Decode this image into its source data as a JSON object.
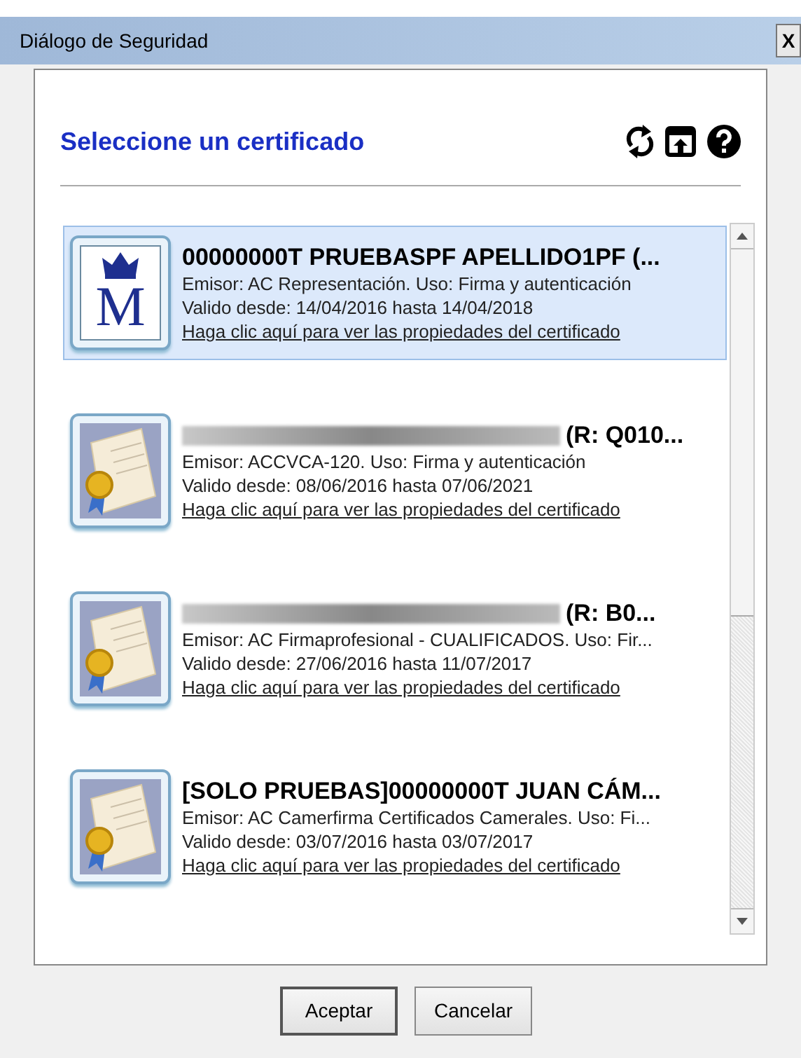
{
  "window": {
    "title": "Diálogo de Seguridad",
    "close_label": "X"
  },
  "header": {
    "title": "Seleccione un certificado"
  },
  "certificates": [
    {
      "kind": "emblem",
      "logo_letter": "M",
      "selected": true,
      "name_blurred": false,
      "name": "00000000T PRUEBASPF APELLIDO1PF (...",
      "issuer": "Emisor: AC Representación. Uso: Firma y autenticación",
      "validity": "Valido desde: 14/04/2016 hasta 14/04/2018",
      "link": "Haga clic aquí para ver las propiedades del certificado"
    },
    {
      "kind": "certificate",
      "selected": false,
      "name_blurred": true,
      "name": "(R: Q010...",
      "issuer": "Emisor: ACCVCA-120. Uso: Firma y autenticación",
      "validity": "Valido desde: 08/06/2016 hasta 07/06/2021",
      "link": "Haga clic aquí para ver las propiedades del certificado"
    },
    {
      "kind": "certificate",
      "selected": false,
      "name_blurred": true,
      "name": "(R: B0...",
      "issuer": "Emisor: AC Firmaprofesional - CUALIFICADOS. Uso: Fir...",
      "validity": "Valido desde: 27/06/2016 hasta 11/07/2017",
      "link": "Haga clic aquí para ver las propiedades del certificado"
    },
    {
      "kind": "certificate",
      "selected": false,
      "name_blurred": false,
      "name": "[SOLO PRUEBAS]00000000T JUAN CÁM...",
      "issuer": "Emisor: AC Camerfirma Certificados Camerales. Uso: Fi...",
      "validity": "Valido desde: 03/07/2016 hasta 03/07/2017",
      "link": "Haga clic aquí para ver las propiedades del certificado"
    }
  ],
  "buttons": [
    {
      "label": "Aceptar",
      "default": true
    },
    {
      "label": "Cancelar",
      "default": false
    }
  ]
}
